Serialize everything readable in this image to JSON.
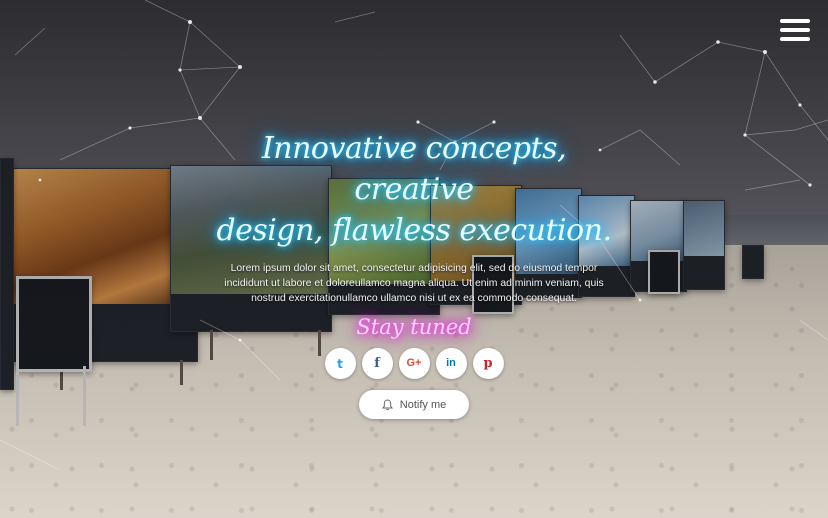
{
  "hero": {
    "headline_line1": "Innovative concepts, creative",
    "headline_line2": "design, flawless execution.",
    "body": "Lorem ipsum dolor sit amet, consectetur adipisicing elit, sed do eiusmod tempor incididunt ut labore et doloreullamco magna aliqua. Ut enim ad minim veniam, quis nostrud exercitationullamco ullamco nisi ut ex ea commodo consequat.",
    "subheadline": "Stay tuned"
  },
  "social": [
    {
      "name": "twitter-icon",
      "glyph": "t",
      "color": "#1da1f2"
    },
    {
      "name": "facebook-icon",
      "glyph": "f",
      "color": "#3b5998"
    },
    {
      "name": "google-plus-icon",
      "glyph": "G+",
      "color": "#dd4b39"
    },
    {
      "name": "linkedin-icon",
      "glyph": "in",
      "color": "#0077b5"
    },
    {
      "name": "pinterest-icon",
      "glyph": "p",
      "color": "#cb2027"
    }
  ],
  "notify": {
    "label": "Notify me",
    "icon": "bell-icon"
  },
  "menu": {
    "icon": "hamburger-menu-icon"
  },
  "colors": {
    "headline_glow": "#19b4ff",
    "subheadline_glow": "#e01ad6"
  }
}
